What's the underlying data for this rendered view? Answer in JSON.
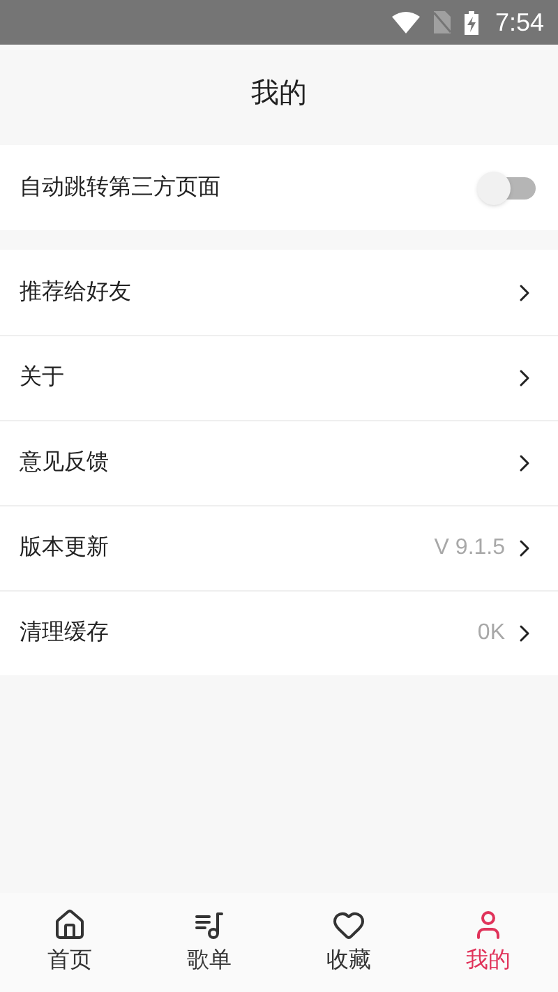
{
  "status_bar": {
    "time": "7:54"
  },
  "header": {
    "title": "我的"
  },
  "toggle_row": {
    "label": "自动跳转第三方页面",
    "on": false
  },
  "menu": [
    {
      "label": "推荐给好友"
    },
    {
      "label": "关于"
    },
    {
      "label": "意见反馈"
    },
    {
      "label": "版本更新",
      "value": "V 9.1.5"
    },
    {
      "label": "清理缓存",
      "value": "0K"
    }
  ],
  "tab_bar": [
    {
      "kind": "home",
      "label": "首页",
      "selected": false
    },
    {
      "kind": "playlist",
      "label": "歌单",
      "selected": false
    },
    {
      "kind": "favorite",
      "label": "收藏",
      "selected": false
    },
    {
      "kind": "profile",
      "label": "我的",
      "selected": true
    }
  ]
}
